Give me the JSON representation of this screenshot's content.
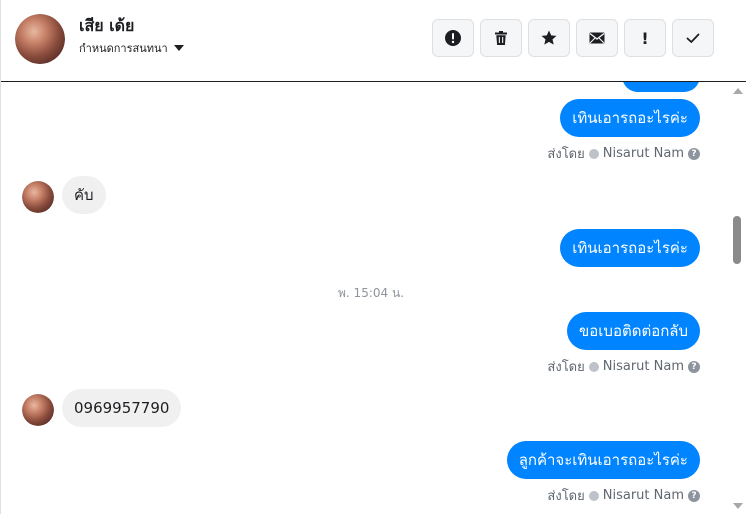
{
  "header": {
    "contact_name": "เสีย เด้ย",
    "manage_label": "กำหนดการสนทนา",
    "toolbar": [
      {
        "name": "report-button",
        "icon": "exclamation-circle-icon"
      },
      {
        "name": "delete-button",
        "icon": "trash-icon"
      },
      {
        "name": "star-button",
        "icon": "star-icon"
      },
      {
        "name": "mark-unread-button",
        "icon": "envelope-icon"
      },
      {
        "name": "spam-button",
        "icon": "exclamation-icon",
        "glyph": "!"
      },
      {
        "name": "mark-done-button",
        "icon": "check-icon"
      }
    ]
  },
  "messages": {
    "m1": {
      "text": "เทินเอารถอะไรค่ะ",
      "sent_by_prefix": "ส่งโดย",
      "sender": "Nisarut Nam"
    },
    "m2": {
      "text": "คับ"
    },
    "m3": {
      "text": "เทินเอารถอะไรค่ะ"
    },
    "timestamp": "พ. 15:04 น.",
    "m4": {
      "text": "ขอเบอติดต่อกลับ",
      "sent_by_prefix": "ส่งโดย",
      "sender": "Nisarut Nam"
    },
    "m5": {
      "text": "0969957790"
    },
    "m6": {
      "text": "ลูกค้าจะเทินเอารถอะไรค่ะ",
      "sent_by_prefix": "ส่งโดย",
      "sender": "Nisarut Nam"
    },
    "help_glyph": "?"
  },
  "colors": {
    "outgoing_bubble": "#0084ff",
    "incoming_bubble": "#f1f0f0",
    "meta_text": "#606770"
  }
}
